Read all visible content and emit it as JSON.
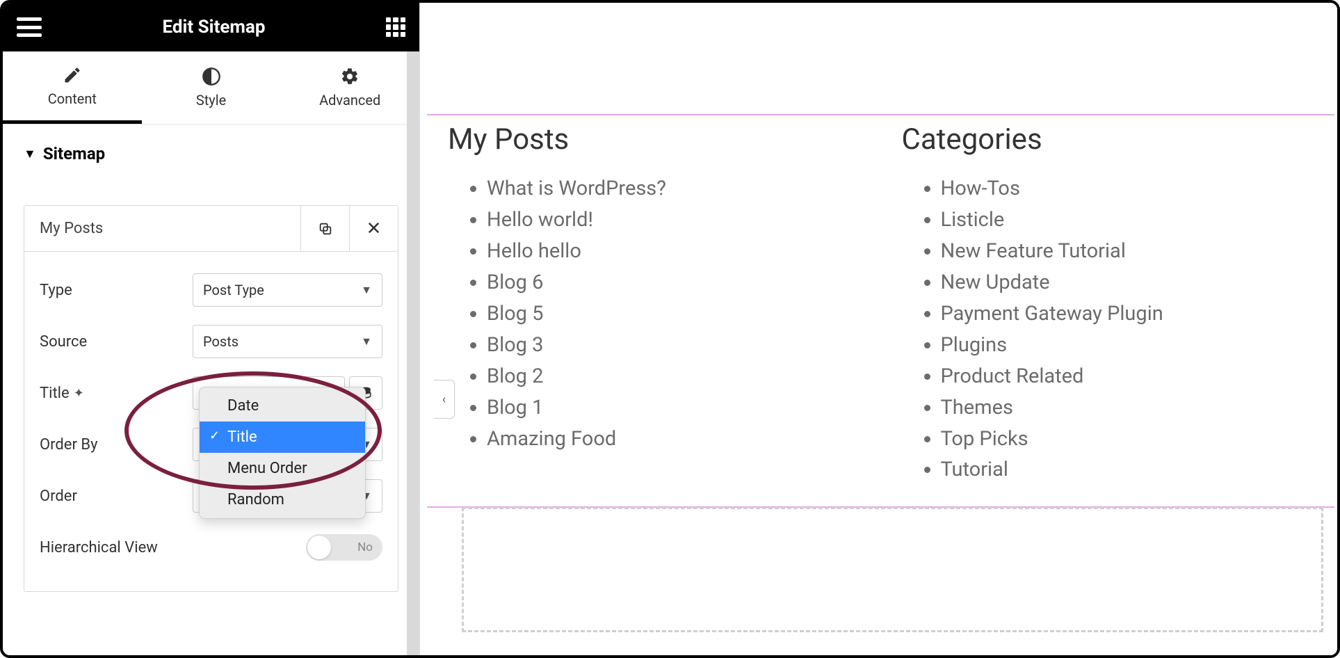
{
  "header": {
    "title": "Edit Sitemap"
  },
  "tabs": {
    "content": "Content",
    "style": "Style",
    "advanced": "Advanced"
  },
  "section": {
    "title": "Sitemap"
  },
  "card": {
    "title": "My Posts",
    "fields": {
      "type": {
        "label": "Type",
        "value": "Post Type"
      },
      "source": {
        "label": "Source",
        "value": "Posts"
      },
      "title": {
        "label": "Title",
        "value": "My Posts"
      },
      "orderby": {
        "label": "Order By",
        "value": "Title"
      },
      "order": {
        "label": "Order",
        "value": ""
      },
      "hier": {
        "label": "Hierarchical View",
        "value": "No"
      }
    }
  },
  "dropdown": {
    "options": [
      "Date",
      "Title",
      "Menu Order",
      "Random"
    ],
    "selected": "Title"
  },
  "preview": {
    "columns": [
      {
        "heading": "My Posts",
        "items": [
          "What is WordPress?",
          "Hello world!",
          "Hello hello",
          "Blog 6",
          "Blog 5",
          "Blog 3",
          "Blog 2",
          "Blog 1",
          "Amazing Food"
        ]
      },
      {
        "heading": "Categories",
        "items": [
          "How-Tos",
          "Listicle",
          "New Feature Tutorial",
          "New Update",
          "Payment Gateway Plugin",
          "Plugins",
          "Product Related",
          "Themes",
          "Top Picks",
          "Tutorial"
        ]
      }
    ]
  }
}
